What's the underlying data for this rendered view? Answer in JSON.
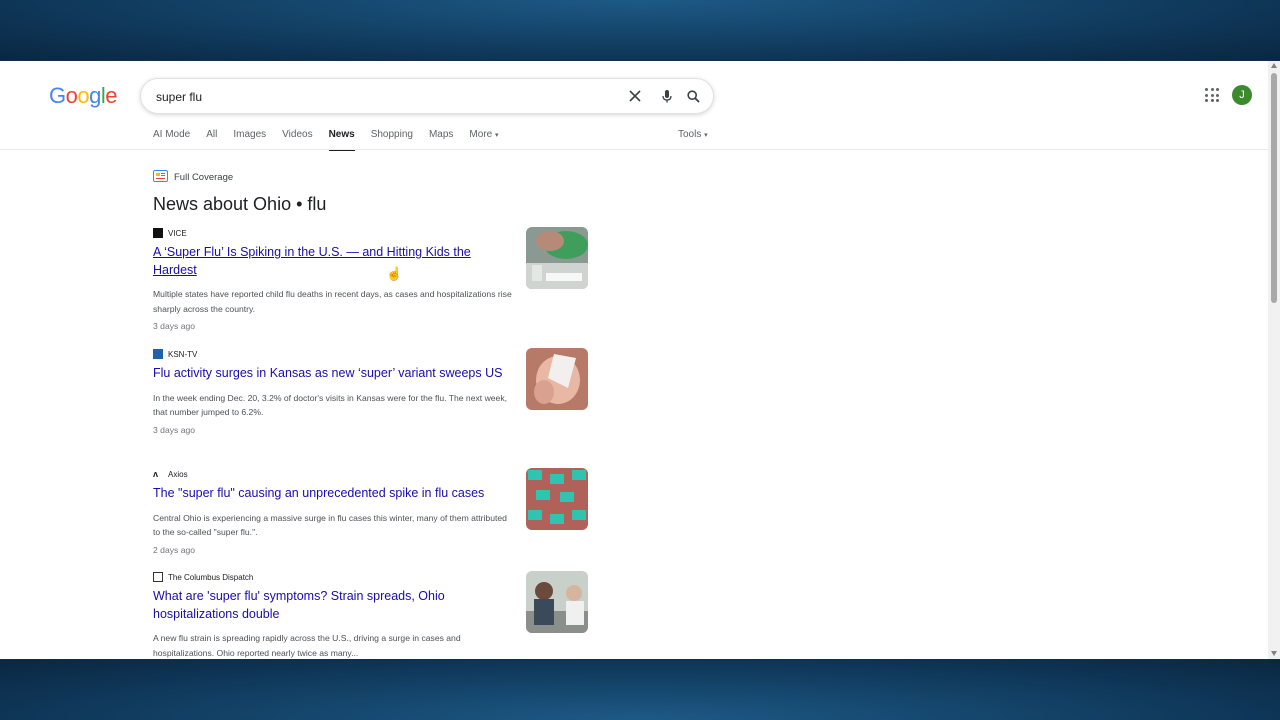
{
  "search": {
    "query": "super flu"
  },
  "tabs": [
    "AI Mode",
    "All",
    "Images",
    "Videos",
    "News",
    "Shopping",
    "Maps",
    "More"
  ],
  "active_tab": "News",
  "tools_label": "Tools",
  "avatar_letter": "J",
  "full_coverage_label": "Full Coverage",
  "section_heading": "News about Ohio • flu",
  "articles": [
    {
      "source": "VICE",
      "title": "A ‘Super Flu’ Is Spiking in the U.S. — and Hitting Kids the Hardest",
      "snippet": "Multiple states have reported child flu deaths in recent days, as cases and hospitalizations rise sharply across the country.",
      "age": "3 days ago"
    },
    {
      "source": "KSN-TV",
      "title": "Flu activity surges in Kansas as new ‘super’ variant sweeps US",
      "snippet": "In the week ending Dec. 20, 3.2% of doctor's visits in Kansas were for the flu. The next week, that number jumped to 6.2%.",
      "age": "3 days ago"
    },
    {
      "source": "Axios",
      "title": "The \"super flu\" causing an unprecedented spike in flu cases",
      "snippet": "Central Ohio is experiencing a massive surge in flu cases this winter, many of them attributed to the so-called \"super flu.\".",
      "age": "2 days ago"
    },
    {
      "source": "The Columbus Dispatch",
      "title": "What are 'super flu' symptoms? Strain spreads, Ohio hospitalizations double",
      "snippet": "A new flu strain is spreading rapidly across the U.S., driving a surge in cases and hospitalizations. Ohio reported nearly twice as many...",
      "age": ""
    }
  ],
  "icons": [
    "close-icon",
    "mic-icon",
    "search-icon",
    "apps-grid-icon",
    "full-coverage-icon",
    "chevron-down-icon"
  ]
}
